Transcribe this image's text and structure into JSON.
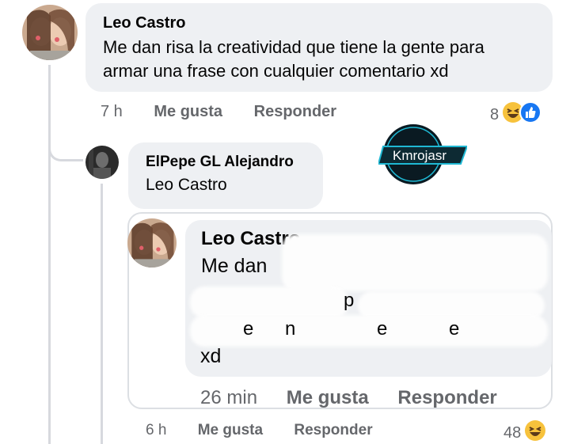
{
  "comment": {
    "author": "Leo Castro",
    "text_line1": "Me dan risa la creatividad que tiene la gente para",
    "text_line2": "armar una frase con cualquier comentario xd",
    "time": "7 h",
    "like_label": "Me gusta",
    "reply_label": "Responder",
    "reaction_count": "8",
    "reactions": [
      "laughing-emoji-icon",
      "like-thumb-icon"
    ]
  },
  "reply": {
    "author": "ElPepe GL Alejandro",
    "text": "Leo Castro",
    "time": "6 h",
    "like_label": "Me gusta",
    "reply_label": "Responder",
    "reaction_count": "48",
    "reactions": [
      "laughing-emoji-icon"
    ]
  },
  "embedded_comment": {
    "author": "Leo Castro",
    "text_line1": "Me dan",
    "frag_p": "p",
    "frag_e1": "e",
    "frag_n": "n",
    "frag_e2": "e",
    "frag_e3": "e",
    "text_last": "xd",
    "time": "26 min",
    "like_label": "Me gusta",
    "reply_label": "Responder"
  },
  "watermark": {
    "text": "Kmrojasr",
    "color": "#1fb8d3"
  },
  "colors": {
    "bubble": "#eef0f3",
    "meta": "#65676b",
    "like_blue": "#1877f2",
    "emoji_yellow": "#f7c23c"
  }
}
